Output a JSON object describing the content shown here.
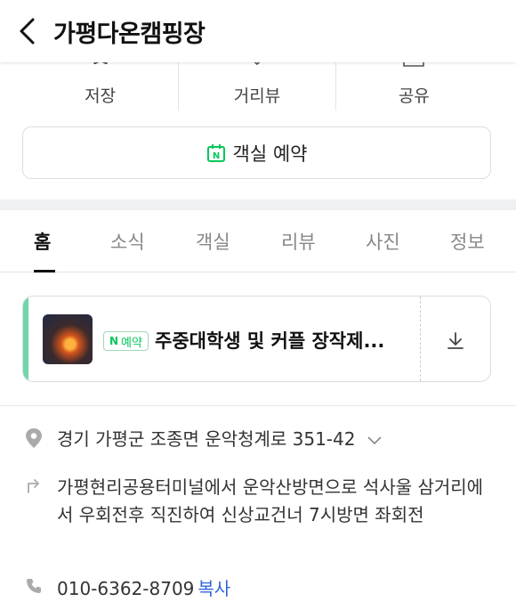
{
  "header": {
    "title": "가평다온캠핑장"
  },
  "actions": [
    {
      "label": "저장",
      "icon": "star-icon"
    },
    {
      "label": "거리뷰",
      "icon": "streetview-icon"
    },
    {
      "label": "공유",
      "icon": "share-icon"
    }
  ],
  "reserve": {
    "label": "객실 예약",
    "icon": "naver-calendar-icon"
  },
  "tabs": [
    "홈",
    "소식",
    "객실",
    "리뷰",
    "사진",
    "정보"
  ],
  "promo": {
    "badge_letter": "N",
    "badge_label": "예약",
    "text": "주중대학생 및 커플 장작제...",
    "accent_color": "#6fd6a9"
  },
  "info": {
    "address": "경기 가평군 조종면 운악청계로 351-42",
    "directions": "가평현리공용터미널에서 운악산방면으로 석사울 삼거리에서 우회전후 직진하여 신상교건너 7시방면 좌회전",
    "phone": "010-6362-8709",
    "copy_label": "복사"
  },
  "colors": {
    "naver_green": "#03c75a",
    "link_blue": "#3066d9"
  }
}
